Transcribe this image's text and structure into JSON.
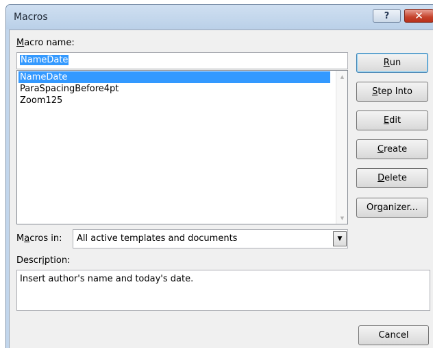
{
  "window": {
    "title": "Macros",
    "help_label": "?",
    "close_label": "✕"
  },
  "macro_name": {
    "label_mnemonic": "M",
    "label_rest": "acro name:",
    "value": "NameDate"
  },
  "macro_list": {
    "items": [
      "NameDate",
      "ParaSpacingBefore4pt",
      "Zoom125"
    ],
    "selected_index": 0
  },
  "buttons": {
    "run": {
      "mnemonic": "R",
      "rest": "un"
    },
    "step_into": {
      "mnemonic": "S",
      "rest": "tep Into"
    },
    "edit": {
      "mnemonic": "E",
      "rest": "dit"
    },
    "create": {
      "mnemonic": "C",
      "rest": "reate"
    },
    "delete": {
      "mnemonic": "D",
      "rest": "elete"
    },
    "organizer": {
      "pre": "Or",
      "mnemonic": "g",
      "rest": "anizer..."
    },
    "cancel": "Cancel"
  },
  "macros_in": {
    "label_pre": "M",
    "label_mnemonic": "a",
    "label_rest": "cros in:",
    "value": "All active templates and documents"
  },
  "description": {
    "label_pre": "Descr",
    "label_mnemonic": "i",
    "label_rest": "ption:",
    "value": "Insert author's name and today's date."
  },
  "colors": {
    "selection": "#3399ff",
    "title_bar": "#c2d6ec",
    "close_button": "#c5432c"
  }
}
